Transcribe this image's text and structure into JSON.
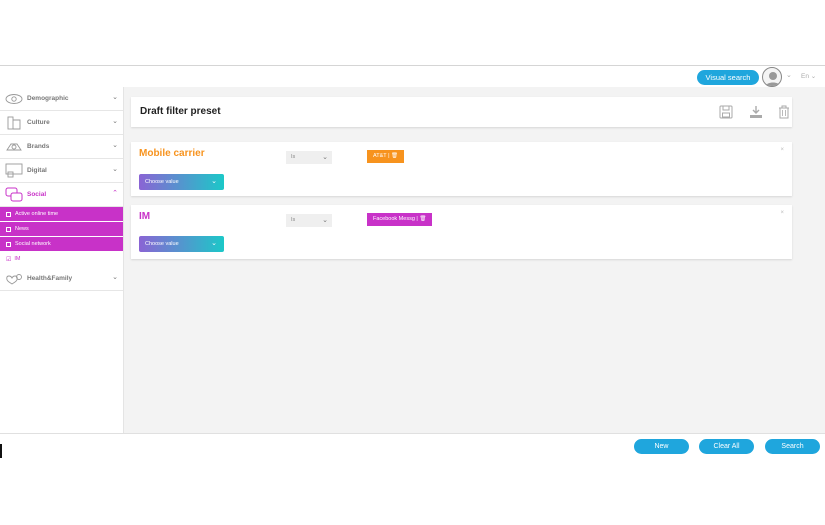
{
  "topbar": {
    "visual_search_label": "Visual search",
    "language": "En"
  },
  "sidebar": {
    "categories": [
      {
        "label": "Demographic",
        "icon": "eye-icon"
      },
      {
        "label": "Culture",
        "icon": "culture-icon"
      },
      {
        "label": "Brands",
        "icon": "brands-icon"
      },
      {
        "label": "Digital",
        "icon": "digital-icon"
      },
      {
        "label": "Social",
        "icon": "social-icon"
      },
      {
        "label": "Health&Family",
        "icon": "health-icon"
      }
    ],
    "social_items": [
      {
        "label": "Active online time",
        "checked": false
      },
      {
        "label": "News",
        "checked": false
      },
      {
        "label": "Social network",
        "checked": false
      },
      {
        "label": "IM",
        "checked": true
      }
    ]
  },
  "preset": {
    "title": "Draft filter preset"
  },
  "filters": [
    {
      "title": "Mobile carrier",
      "title_color": "#f7931e",
      "operator": "Is",
      "value_chip": "AT&T |",
      "chip_color": "#f7931e",
      "choose_label": "Choose value",
      "close": "×"
    },
    {
      "title": "IM",
      "title_color": "#c832c8",
      "operator": "Is",
      "value_chip": "Facebook Messg |",
      "chip_color": "#c832c8",
      "choose_label": "Choose value",
      "close": "×"
    }
  ],
  "bottom": {
    "new_label": "New",
    "clear_label": "Clear All",
    "search_label": "Search"
  },
  "colors": {
    "accent_blue": "#1fa6dd",
    "social_magenta": "#c832c8",
    "carrier_orange": "#f7931e"
  }
}
